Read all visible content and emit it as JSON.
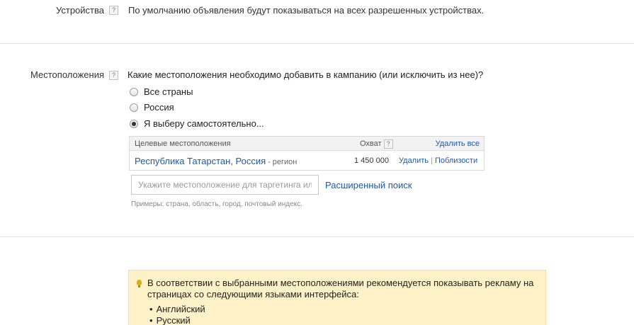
{
  "devices": {
    "label": "Устройства",
    "help": "?",
    "text": "По умолчанию объявления будут показываться на всех разрешенных устройствах."
  },
  "locations": {
    "label": "Местоположения",
    "help": "?",
    "question": "Какие местоположения необходимо добавить в кампанию (или исключить из нее)?",
    "options": [
      {
        "label": "Все страны",
        "checked": false
      },
      {
        "label": "Россия",
        "checked": false
      },
      {
        "label": "Я выберу самостоятельно...",
        "checked": true
      }
    ],
    "table": {
      "col_name": "Целевые местоположения",
      "col_reach": "Охват",
      "col_reach_help": "?",
      "delete_all": "Удалить все",
      "rows": [
        {
          "name": "Республика Татарстан, Россия",
          "type": "- регион",
          "reach": "1 450 000",
          "delete": "Удалить",
          "separator": "|",
          "nearby": "Поблизости"
        }
      ]
    },
    "search_placeholder": "Укажите местоположение для таргетинга или исключения",
    "advanced_search": "Расширенный поиск",
    "examples": "Примеры: страна, область, город, почтовый индекс."
  },
  "notice": {
    "text": "В соответствии с выбранными местоположениями рекомендуется показывать рекламу на страницах со следующими языками интерфейса:",
    "languages": [
      "Английский",
      "Русский"
    ],
    "icon": "lightbulb-icon",
    "background": "#fcf1c7"
  }
}
